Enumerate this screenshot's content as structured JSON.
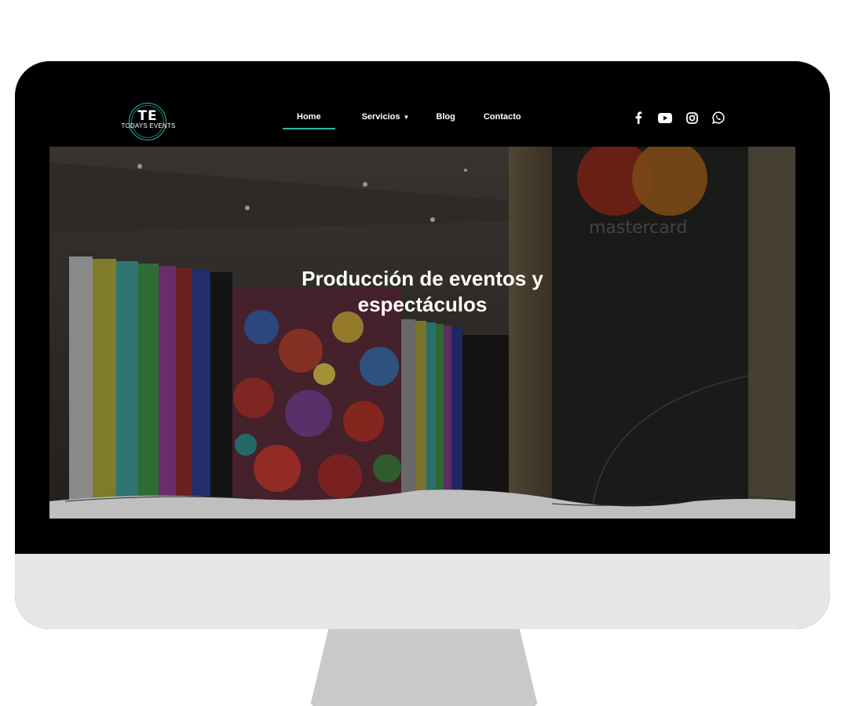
{
  "brand": {
    "monogram": "TE",
    "name": "TODAYS EVENTS"
  },
  "nav": {
    "items": [
      {
        "label": "Home",
        "active": true
      },
      {
        "label": "Servicios",
        "has_dropdown": true
      },
      {
        "label": "Blog"
      },
      {
        "label": "Contacto"
      }
    ]
  },
  "social": {
    "icons": [
      "facebook-icon",
      "youtube-icon",
      "instagram-icon",
      "whatsapp-icon"
    ]
  },
  "hero": {
    "title": "Producción de eventos y espectáculos",
    "sign_text": "mastercard"
  },
  "colors": {
    "accent": "#2bb7ad",
    "header_bg": "#000000",
    "monitor_frame": "#000000",
    "monitor_chin": "#e6e6e6",
    "monitor_stand": "#c9c9c9"
  }
}
